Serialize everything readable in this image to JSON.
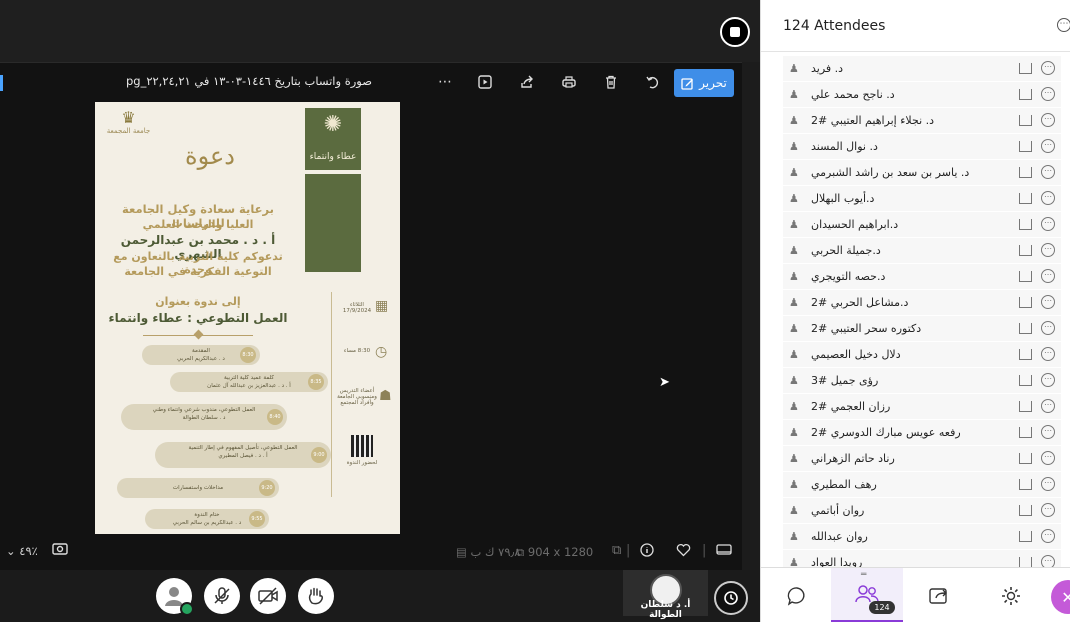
{
  "viewer": {
    "file_title": "صورة واتساب بتاريخ ١٤٤٦-٠٣-١٣ في ٢٢,٢٤,٢١_٥f٤a١٣٩jpg",
    "edit_label": "تحرير",
    "zoom_level": "٤٩٪",
    "file_dims": "904 x 1280",
    "file_size": "٧٩٫٨ ك ب"
  },
  "poster": {
    "brand": "عطاء وانتماء",
    "university": "جامعة المجمعة",
    "invite_word": "دعوة",
    "line1": "برعاية سعادة وكيل الجامعة للدراسات",
    "line2": "العليا والبحث العلمي",
    "line3": "أ . د . محمد بن عبدالرحمن الشهري",
    "line4": "تدعوكم كلية التربية بالتعاون مع وحدة",
    "line5": "التوعية الفكرية في الجامعة",
    "line6": "إلى ندوة بعنوان",
    "line7": "العمل التطوعي : عطاء وانتماء",
    "day": "الثلاثاء",
    "date": "17/9/2024",
    "time_label": "8:30 مساء",
    "audience": "أعضاء التدريس ومنسوبي الجامعة وأفراد المجتمع",
    "register": "لحضور الندوة",
    "program": [
      {
        "title": "المقدمة",
        "speaker": "د . عبدالكريم الحربي",
        "time": "8:30"
      },
      {
        "title": "كلمة عميد كلية التربية",
        "speaker": "أ . د . عبدالعزيز بن عبدالله آل عثمان",
        "time": "8:35"
      },
      {
        "title": "العمل التطوعي، مندوب شرعي وانتماء وطني",
        "speaker": "د . سلطان الطوالة",
        "time": "8:40"
      },
      {
        "title": "العمل التطوعي، تأصيل المفهوم في إطار التنمية",
        "speaker": "أ . د . فيصل المطيري",
        "time": "9:00"
      },
      {
        "title": "مداخلات واستفسارات",
        "speaker": "",
        "time": "9:20"
      },
      {
        "title": "ختام الندوة",
        "speaker": "د . عبدالكريم بن سالم الحربي",
        "time": "9:55"
      }
    ]
  },
  "controls": {
    "speaker_name": "أ. د سلطان الطوالة"
  },
  "panel": {
    "title": "124 Attendees",
    "badge": "124",
    "attendees": [
      "د. فريد",
      "د. ناجح محمد علي",
      "د. نجلاء إبراهيم العتيبي #2",
      "د. نوال المسند",
      "د. ياسر بن سعد بن راشد الشبرمي",
      "د.أيوب البهلال",
      "د.ابراهيم الحسيدان",
      "د.جميلة الحربي",
      "د.حصه التويجري",
      "د.مشاعل الحربي #2",
      "دكتوره سحر العتيبي #2",
      "دلال دخيل العصيمي",
      "رؤى جميل #3",
      "رزان العجمي #2",
      "رفعه عويس مبارك الدوسري #2",
      "رناد حاتم الزهراني",
      "رهف المطيري",
      "روان أباتمي",
      "روان عبدالله",
      "رويدا العواد"
    ]
  }
}
